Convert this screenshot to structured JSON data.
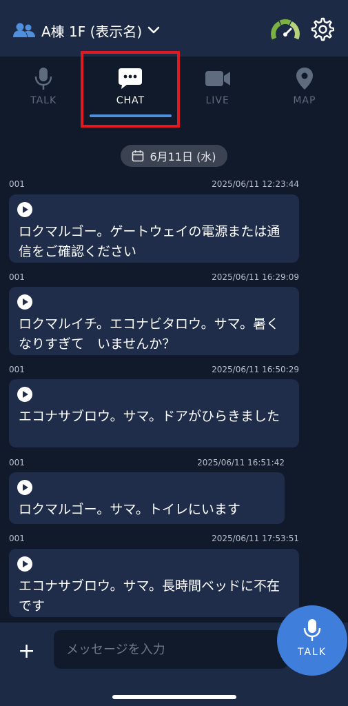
{
  "header": {
    "group_name": "A棟 1F (表示名)",
    "icons": {
      "group": "users-icon",
      "dropdown": "chevron-down-icon",
      "status": "gauge-icon",
      "settings": "gear-icon"
    }
  },
  "tabs": [
    {
      "label": "TALK",
      "icon": "microphone-icon",
      "active": false
    },
    {
      "label": "CHAT",
      "icon": "chat-bubble-icon",
      "active": true
    },
    {
      "label": "LIVE",
      "icon": "video-camera-icon",
      "active": false
    },
    {
      "label": "MAP",
      "icon": "map-pin-icon",
      "active": false
    }
  ],
  "date_pill": {
    "label": "6月11日 (水)",
    "icon": "calendar-icon"
  },
  "messages": [
    {
      "sender": "001",
      "timestamp": "2025/06/11 12:23:44",
      "text": "ロクマルゴー。ゲートウェイの電源または通信をご確認ください"
    },
    {
      "sender": "001",
      "timestamp": "2025/06/11 16:29:09",
      "text": "ロクマルイチ。エコナビタロウ。サマ。暑く　なりすぎて　いませんか？"
    },
    {
      "sender": "001",
      "timestamp": "2025/06/11 16:50:29",
      "text": "エコナサブロウ。サマ。ドアがひらきました"
    },
    {
      "sender": "001",
      "timestamp": "2025/06/11 16:51:42",
      "text": "ロクマルゴー。サマ。トイレにいます"
    },
    {
      "sender": "001",
      "timestamp": "2025/06/11 17:53:51",
      "text": "エコナサブロウ。サマ。長時間ベッドに不在です"
    }
  ],
  "input": {
    "placeholder": "メッセージを入力",
    "plus_label": "+"
  },
  "talk_button": {
    "label": "TALK"
  },
  "colors": {
    "background": "#111a2b",
    "header": "#1c2a45",
    "bubble": "#1f2d4a",
    "accent": "#3f7fdb",
    "highlight": "#e01a22"
  }
}
